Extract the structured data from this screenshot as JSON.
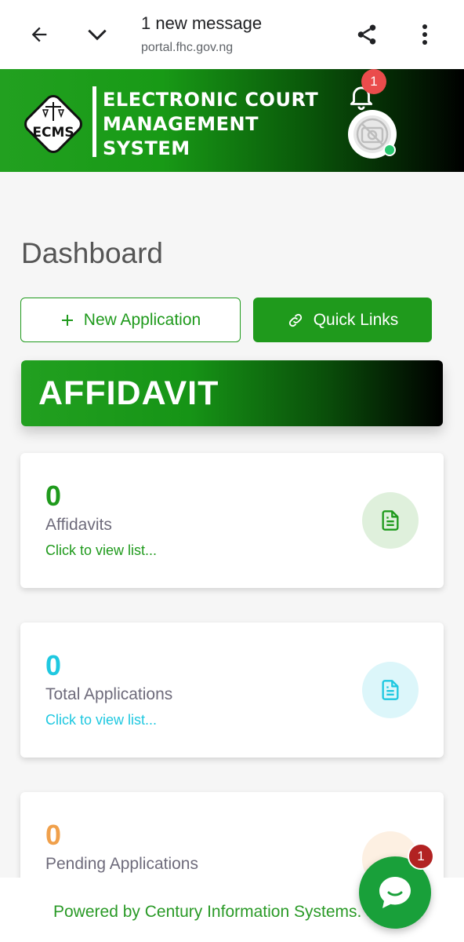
{
  "browser": {
    "title": "1 new message",
    "url": "portal.fhc.gov.ng",
    "icons": [
      "back-arrow-icon",
      "chevron-down-icon",
      "share-icon",
      "more-vert-icon"
    ]
  },
  "header": {
    "logo_abbrev": "ECMS",
    "logo_line1": "ELECTRONIC COURT",
    "logo_line2": "MANAGEMENT",
    "logo_line3": "SYSTEM",
    "notification_count": "1",
    "colors": {
      "brand_green": "#1f9a1c",
      "online": "#28c76f",
      "badge": "#ea4c4c"
    }
  },
  "main": {
    "page_title": "Dashboard",
    "new_application_label": "New Application",
    "quick_links_label": "Quick Links",
    "section_title": "AFFIDAVIT",
    "cards": [
      {
        "value": "0",
        "label": "Affidavits",
        "link": "Click to view list...",
        "color": "#1f9a1c",
        "icon": "document-icon"
      },
      {
        "value": "0",
        "label": "Total Applications",
        "link": "Click to view list...",
        "color": "#1fc8e0",
        "icon": "document-icon"
      },
      {
        "value": "0",
        "label": "Pending Applications",
        "color": "#f0a04b",
        "icon": "document-icon"
      }
    ]
  },
  "footer": {
    "text": "Powered by Century Information Systems."
  },
  "chat": {
    "badge_count": "1"
  }
}
